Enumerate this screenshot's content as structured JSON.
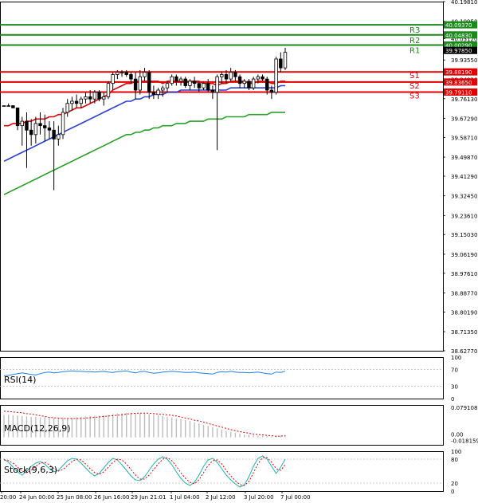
{
  "chart_data": [
    {
      "panel": "price",
      "type": "candlestick",
      "ylim": [
        38.6277,
        40.1981
      ],
      "y_ticks": [
        "40.19810",
        "40.10950",
        "40.03120",
        "39.97850",
        "39.93550",
        "39.84830",
        "39.76130",
        "39.67290",
        "39.58710",
        "39.49870",
        "39.41290",
        "39.32450",
        "39.23610",
        "39.15030",
        "39.06190",
        "38.97610",
        "38.88770",
        "38.80190",
        "38.71350",
        "38.62770"
      ],
      "x_labels": [
        "20:00",
        "24 Jun 00:00",
        "25 Jun 08:00",
        "26 Jun 16:00",
        "29 Jun 21:01",
        "1 Jul 04:00",
        "2 Jul 12:00",
        "3 Jul 20:00",
        "7 Jul 00:00"
      ],
      "current_price_label": "39.97850",
      "levels": [
        {
          "name": "R3",
          "value": 40.0937,
          "label": "40.09370",
          "color": "#1a8a1a"
        },
        {
          "name": "R2",
          "value": 40.0483,
          "label": "40.04830",
          "color": "#1a8a1a"
        },
        {
          "name": "R1",
          "value": 40.0029,
          "label": "40.00290",
          "color": "#1a8a1a"
        },
        {
          "name": "S1",
          "value": 39.8819,
          "label": "39.88190",
          "color": "#e00000"
        },
        {
          "name": "S2",
          "value": 39.8365,
          "label": "39.83650",
          "color": "#e00000"
        },
        {
          "name": "S3",
          "value": 39.7911,
          "label": "39.79110",
          "color": "#e00000"
        }
      ],
      "candles": [
        [
          39.73,
          39.73,
          39.73,
          39.73
        ],
        [
          39.73,
          39.74,
          39.73,
          39.73
        ],
        [
          39.73,
          39.73,
          39.72,
          39.72
        ],
        [
          39.72,
          39.72,
          39.62,
          39.64
        ],
        [
          39.64,
          39.68,
          39.55,
          39.66
        ],
        [
          39.66,
          39.7,
          39.45,
          39.62
        ],
        [
          39.62,
          39.67,
          39.55,
          39.6
        ],
        [
          39.6,
          39.68,
          39.56,
          39.65
        ],
        [
          39.65,
          39.7,
          39.6,
          39.64
        ],
        [
          39.64,
          39.69,
          39.57,
          39.63
        ],
        [
          39.63,
          39.66,
          39.58,
          39.62
        ],
        [
          39.62,
          39.66,
          39.35,
          39.58
        ],
        [
          39.58,
          39.64,
          39.55,
          39.6
        ],
        [
          39.6,
          39.72,
          39.58,
          39.7
        ],
        [
          39.7,
          39.76,
          39.68,
          39.74
        ],
        [
          39.74,
          39.77,
          39.71,
          39.75
        ],
        [
          39.75,
          39.78,
          39.72,
          39.74
        ],
        [
          39.74,
          39.77,
          39.72,
          39.76
        ],
        [
          39.76,
          39.79,
          39.74,
          39.77
        ],
        [
          39.77,
          39.8,
          39.74,
          39.76
        ],
        [
          39.76,
          39.8,
          39.74,
          39.79
        ],
        [
          39.79,
          39.8,
          39.75,
          39.76
        ],
        [
          39.76,
          39.79,
          39.73,
          39.77
        ],
        [
          39.77,
          39.84,
          39.76,
          39.83
        ],
        [
          39.83,
          39.88,
          39.8,
          39.87
        ],
        [
          39.87,
          39.89,
          39.85,
          39.88
        ],
        [
          39.88,
          39.89,
          39.86,
          39.88
        ],
        [
          39.88,
          39.89,
          39.86,
          39.87
        ],
        [
          39.87,
          39.88,
          39.83,
          39.85
        ],
        [
          39.85,
          39.88,
          39.76,
          39.8
        ],
        [
          39.8,
          39.89,
          39.78,
          39.86
        ],
        [
          39.86,
          39.9,
          39.84,
          39.88
        ],
        [
          39.88,
          39.89,
          39.76,
          39.79
        ],
        [
          39.79,
          39.82,
          39.76,
          39.78
        ],
        [
          39.78,
          39.81,
          39.76,
          39.8
        ],
        [
          39.8,
          39.82,
          39.77,
          39.81
        ],
        [
          39.81,
          39.84,
          39.79,
          39.83
        ],
        [
          39.83,
          39.87,
          39.82,
          39.86
        ],
        [
          39.86,
          39.87,
          39.82,
          39.84
        ],
        [
          39.84,
          39.86,
          39.82,
          39.85
        ],
        [
          39.85,
          39.86,
          39.81,
          39.82
        ],
        [
          39.82,
          39.85,
          39.8,
          39.84
        ],
        [
          39.84,
          39.86,
          39.81,
          39.83
        ],
        [
          39.83,
          39.84,
          39.79,
          39.81
        ],
        [
          39.81,
          39.84,
          39.8,
          39.83
        ],
        [
          39.83,
          39.85,
          39.79,
          39.8
        ],
        [
          39.8,
          39.82,
          39.76,
          39.79
        ],
        [
          39.79,
          39.87,
          39.53,
          39.86
        ],
        [
          39.86,
          39.88,
          39.83,
          39.87
        ],
        [
          39.87,
          39.89,
          39.83,
          39.85
        ],
        [
          39.85,
          39.9,
          39.84,
          39.88
        ],
        [
          39.88,
          39.89,
          39.84,
          39.86
        ],
        [
          39.86,
          39.87,
          39.81,
          39.83
        ],
        [
          39.83,
          39.85,
          39.81,
          39.84
        ],
        [
          39.84,
          39.85,
          39.8,
          39.81
        ],
        [
          39.81,
          39.86,
          39.8,
          39.85
        ],
        [
          39.85,
          39.87,
          39.83,
          39.86
        ],
        [
          39.86,
          39.87,
          39.84,
          39.85
        ],
        [
          39.85,
          39.86,
          39.78,
          39.8
        ],
        [
          39.8,
          39.82,
          39.76,
          39.79
        ],
        [
          39.79,
          39.95,
          39.78,
          39.94
        ],
        [
          39.94,
          39.97,
          39.88,
          39.9
        ],
        [
          39.9,
          39.99,
          39.89,
          39.97
        ]
      ],
      "series": [
        {
          "name": "fast-ma",
          "color": "#e00000",
          "values": [
            39.64,
            39.64,
            39.65,
            39.65,
            39.65,
            39.66,
            39.66,
            39.67,
            39.67,
            39.67,
            39.68,
            39.68,
            39.69,
            39.69,
            39.7,
            39.71,
            39.72,
            39.72,
            39.73,
            39.74,
            39.75,
            39.76,
            39.77,
            39.78,
            39.8,
            39.81,
            39.82,
            39.83,
            39.83,
            39.84,
            39.84,
            39.84,
            39.84,
            39.84,
            39.84,
            39.83,
            39.84,
            39.84,
            39.84,
            39.84,
            39.84,
            39.84,
            39.84,
            39.84,
            39.83,
            39.83,
            39.83,
            39.82,
            39.83,
            39.83,
            39.84,
            39.84,
            39.84,
            39.84,
            39.83,
            39.83,
            39.84,
            39.84,
            39.84,
            39.83,
            39.83,
            39.84,
            39.84
          ]
        },
        {
          "name": "mid-ma",
          "color": "#2a3fd0",
          "values": [
            39.48,
            39.49,
            39.5,
            39.51,
            39.52,
            39.53,
            39.54,
            39.55,
            39.56,
            39.57,
            39.58,
            39.59,
            39.6,
            39.61,
            39.62,
            39.63,
            39.64,
            39.65,
            39.66,
            39.67,
            39.68,
            39.69,
            39.7,
            39.71,
            39.72,
            39.73,
            39.74,
            39.75,
            39.75,
            39.76,
            39.76,
            39.77,
            39.77,
            39.78,
            39.78,
            39.78,
            39.79,
            39.79,
            39.79,
            39.8,
            39.8,
            39.8,
            39.8,
            39.8,
            39.8,
            39.8,
            39.8,
            39.8,
            39.8,
            39.8,
            39.81,
            39.81,
            39.81,
            39.81,
            39.81,
            39.81,
            39.81,
            39.81,
            39.81,
            39.81,
            39.81,
            39.82,
            39.82
          ]
        },
        {
          "name": "slow-ma",
          "color": "#2aa02a",
          "values": [
            39.33,
            39.34,
            39.35,
            39.36,
            39.37,
            39.38,
            39.39,
            39.4,
            39.41,
            39.42,
            39.43,
            39.44,
            39.45,
            39.46,
            39.47,
            39.48,
            39.49,
            39.5,
            39.51,
            39.52,
            39.53,
            39.54,
            39.55,
            39.56,
            39.57,
            39.58,
            39.59,
            39.6,
            39.6,
            39.61,
            39.61,
            39.62,
            39.62,
            39.63,
            39.63,
            39.64,
            39.64,
            39.64,
            39.65,
            39.65,
            39.65,
            39.66,
            39.66,
            39.66,
            39.66,
            39.67,
            39.67,
            39.67,
            39.67,
            39.68,
            39.68,
            39.68,
            39.68,
            39.68,
            39.69,
            39.69,
            39.69,
            39.69,
            39.69,
            39.7,
            39.7,
            39.7,
            39.7
          ]
        }
      ]
    },
    {
      "panel": "rsi",
      "type": "line",
      "title": "RSI(14)",
      "ylim": [
        0,
        100
      ],
      "y_ticks": [
        "100",
        "70",
        "30",
        "0"
      ],
      "levels": [
        70,
        30
      ],
      "series": [
        {
          "name": "RSI(14)",
          "color": "#1e7fe0",
          "values": [
            55,
            56,
            58,
            60,
            62,
            60,
            58,
            57,
            60,
            63,
            64,
            62,
            63,
            65,
            66,
            67,
            66,
            66,
            65,
            65,
            64,
            65,
            66,
            64,
            63,
            65,
            66,
            67,
            64,
            62,
            65,
            66,
            63,
            61,
            62,
            64,
            65,
            66,
            65,
            64,
            63,
            63,
            64,
            62,
            61,
            60,
            59,
            63,
            65,
            64,
            66,
            64,
            63,
            63,
            62,
            63,
            64,
            62,
            60,
            59,
            64,
            63,
            66
          ]
        }
      ]
    },
    {
      "panel": "macd",
      "type": "bar",
      "title": "MACD(12,26,9)",
      "ylim": [
        -0.018159,
        0.079108
      ],
      "y_ticks": [
        "0.079108",
        "0.00",
        "-0.018159"
      ],
      "histogram": [
        0.055,
        0.055,
        0.054,
        0.053,
        0.052,
        0.051,
        0.05,
        0.05,
        0.049,
        0.049,
        0.048,
        0.048,
        0.047,
        0.047,
        0.047,
        0.048,
        0.049,
        0.05,
        0.051,
        0.052,
        0.053,
        0.053,
        0.054,
        0.055,
        0.057,
        0.058,
        0.059,
        0.06,
        0.06,
        0.06,
        0.059,
        0.058,
        0.057,
        0.055,
        0.054,
        0.052,
        0.05,
        0.048,
        0.046,
        0.044,
        0.042,
        0.04,
        0.037,
        0.034,
        0.031,
        0.028,
        0.025,
        0.022,
        0.019,
        0.016,
        0.013,
        0.011,
        0.009,
        0.007,
        0.006,
        0.005,
        0.004,
        0.004,
        0.003,
        0.002,
        0.003,
        0.004,
        0.006
      ],
      "signal": [
        0.064,
        0.063,
        0.062,
        0.061,
        0.06,
        0.058,
        0.057,
        0.055,
        0.053,
        0.051,
        0.049,
        0.048,
        0.047,
        0.046,
        0.046,
        0.046,
        0.046,
        0.046,
        0.047,
        0.048,
        0.049,
        0.05,
        0.051,
        0.052,
        0.053,
        0.054,
        0.055,
        0.057,
        0.058,
        0.059,
        0.059,
        0.059,
        0.059,
        0.058,
        0.057,
        0.056,
        0.055,
        0.054,
        0.052,
        0.05,
        0.047,
        0.045,
        0.042,
        0.04,
        0.037,
        0.034,
        0.031,
        0.028,
        0.025,
        0.022,
        0.019,
        0.016,
        0.014,
        0.012,
        0.01,
        0.008,
        0.007,
        0.006,
        0.005,
        0.004,
        0.003,
        0.003,
        0.004
      ]
    },
    {
      "panel": "stoch",
      "type": "line",
      "title": "Stock(9,6,3)",
      "ylim": [
        0,
        100
      ],
      "y_ticks": [
        "100",
        "80",
        "20",
        "0"
      ],
      "levels": [
        80,
        20
      ],
      "series": [
        {
          "name": "main",
          "color": "#20b2b2",
          "values": [
            80,
            72,
            60,
            48,
            40,
            50,
            62,
            70,
            74,
            68,
            56,
            48,
            52,
            64,
            76,
            82,
            80,
            70,
            58,
            46,
            38,
            44,
            58,
            72,
            82,
            78,
            66,
            52,
            38,
            28,
            26,
            36,
            52,
            68,
            80,
            86,
            80,
            66,
            48,
            32,
            20,
            14,
            22,
            40,
            62,
            78,
            82,
            72,
            56,
            40,
            28,
            18,
            10,
            16,
            36,
            62,
            82,
            88,
            80,
            62,
            44,
            60,
            80
          ]
        },
        {
          "name": "signal",
          "color": "#e00000",
          "values": [
            78,
            76,
            70,
            60,
            50,
            46,
            52,
            62,
            70,
            72,
            66,
            56,
            50,
            54,
            64,
            74,
            80,
            78,
            68,
            56,
            46,
            42,
            48,
            60,
            72,
            80,
            78,
            68,
            54,
            40,
            30,
            30,
            40,
            54,
            68,
            80,
            84,
            76,
            62,
            46,
            32,
            22,
            18,
            28,
            46,
            64,
            76,
            78,
            68,
            52,
            38,
            26,
            16,
            14,
            24,
            46,
            68,
            84,
            84,
            72,
            56,
            52,
            66
          ]
        }
      ]
    }
  ]
}
